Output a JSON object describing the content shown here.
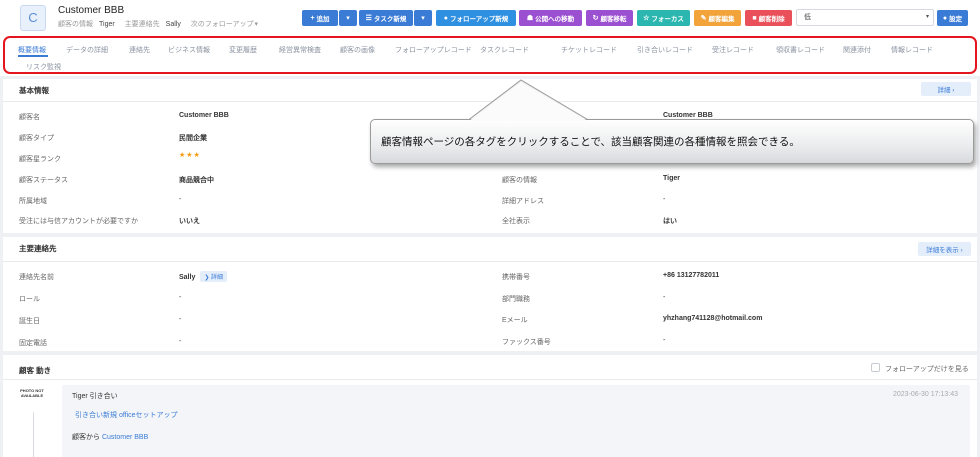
{
  "header": {
    "avatar_letter": "C",
    "customer_name": "Customer BBB",
    "owner_label": "顧客の情報",
    "owner_value": "Tiger",
    "contact_label": "主要連絡先",
    "contact_value": "Sally",
    "next_followup": "次のフォローアップ",
    "followup_caret": "▾"
  },
  "toolbar": {
    "add": "追加",
    "task_new": "タスク新規",
    "followup_new": "フォローアップ新規",
    "public_pool": "公開への移動",
    "transfer": "顧客移転",
    "focus": "フォーカス",
    "edit": "顧客編集",
    "delete": "顧客削除",
    "level_select": "低",
    "settings": "設定",
    "caret": "▾"
  },
  "tabs": [
    "概要情報",
    "データの詳細",
    "連絡先",
    "ビジネス情報",
    "変更履歴",
    "経営異常検査",
    "顧客の画像",
    "フォローアップレコード",
    "タスクレコード",
    "チケットレコード",
    "引き合いレコード",
    "受注レコード",
    "領収書レコード",
    "関連添付",
    "情報レコード",
    "リスク監視"
  ],
  "callout": {
    "text": "顧客情報ページの各タグをクリックすることで、該当顧客関連の各種情報を照会できる。"
  },
  "basic": {
    "title": "基本情報",
    "detail_btn": "詳細 ›",
    "fields": {
      "name_label": "顧客名",
      "name_value": "Customer BBB",
      "name2_value": "Customer BBB",
      "type_label": "顧客タイプ",
      "type_value": "民間企業",
      "rank_label": "顧客星ランク",
      "rank_value": "★★★",
      "status_label": "顧客ステータス",
      "status_value": "商品競合中",
      "owner_label": "顧客の情報",
      "owner_value": "Tiger",
      "region_label": "所属地域",
      "region_value": "-",
      "address_label": "詳細アドレス",
      "address_value": "-",
      "account_label": "受注には与信アカウントが必要ですか",
      "account_value": "いいえ",
      "display_label": "全社表示",
      "display_value": "はい"
    }
  },
  "contact": {
    "title": "主要連絡先",
    "detail_btn": "詳細を表示 ›",
    "fields": {
      "name_label": "連絡先名前",
      "name_value": "Sally",
      "name_tag": "❯ 詳細",
      "mobile_label": "携帯番号",
      "mobile_value": "+86 13127782011",
      "role_label": "ロール",
      "role_value": "-",
      "dept_label": "部門職務",
      "dept_value": "-",
      "birthday_label": "誕生日",
      "birthday_value": "-",
      "email_label": "Eメール",
      "email_value": "yhzhang741128@hotmail.com",
      "phone_label": "固定電話",
      "phone_value": "-",
      "fax_label": "ファックス番号",
      "fax_value": "-"
    }
  },
  "activity": {
    "title": "顧客 動き",
    "followup_only": "フォローアップだけを見る",
    "photo_placeholder": "PHOTO NOT AVAILABLE",
    "entry_title": "Tiger 引き合い",
    "entry_time": "2023-06-30 17:13:43",
    "entry_link": "引き合い新規 officeセットアップ",
    "entry_from": "顧客から",
    "entry_customer": "Customer BBB"
  },
  "colors": {
    "primary": "#3a7bd5",
    "followup": "#2f8fe0",
    "purple": "#9b4fd1",
    "teal": "#2bb7b0",
    "orange": "#f2a33a",
    "red": "#e9505a",
    "highlight": "#e4151f"
  }
}
